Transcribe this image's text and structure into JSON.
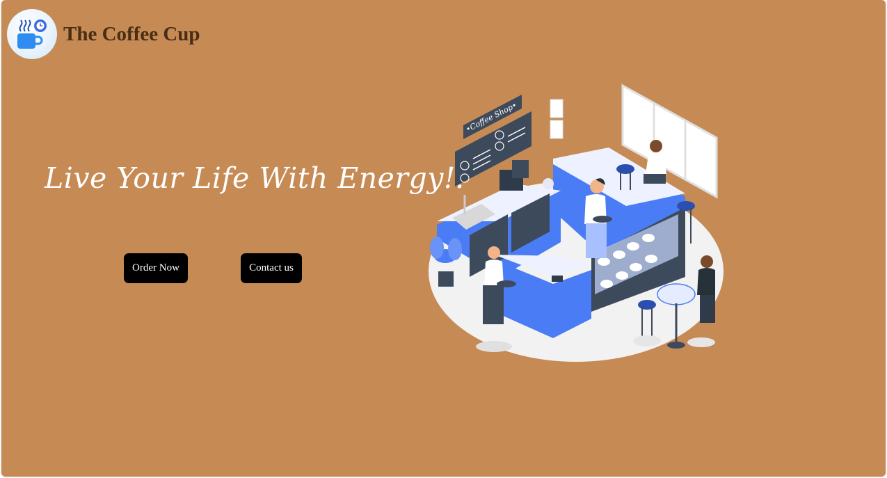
{
  "header": {
    "brand": "The Coffee Cup",
    "logo_icon": "coffee-cup-icon"
  },
  "hero": {
    "tagline": "Live Your Life With Energy!!",
    "order_button": "Order Now",
    "contact_button": "Contact us"
  },
  "illustration": {
    "sign_text": "•Coffee Shop•"
  },
  "colors": {
    "background": "#c68a55",
    "brand_text": "#4a2e14",
    "button": "#000000",
    "accent_blue": "#4a7cf5"
  }
}
